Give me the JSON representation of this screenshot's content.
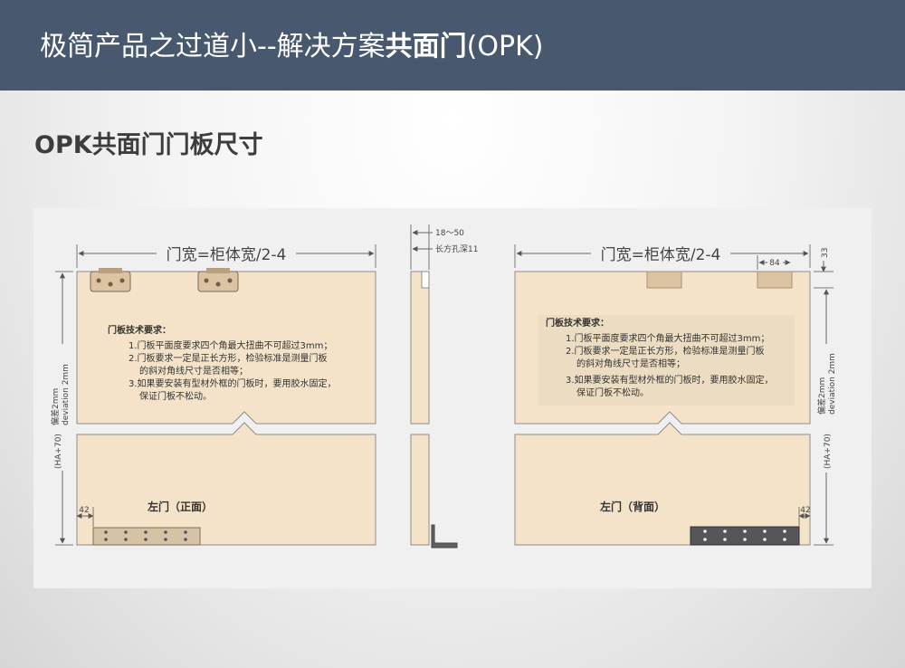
{
  "header": {
    "title_regular": "极简产品之过道小--解决方案",
    "title_bold": "共面门",
    "title_suffix": "(OPK)"
  },
  "section": {
    "heading": "OPK共面门门板尺寸"
  },
  "diagram": {
    "door_width_formula": "门宽=柜体宽/2-4",
    "side_gap_range": "18～50",
    "slot_depth": "长方孔深11",
    "dim_84": "84",
    "dim_33": "33",
    "dim_42": "42",
    "height_formula": "(HA+70)",
    "deviation_cn": "偏差2mm",
    "deviation_en": "deviation 2mm",
    "requirements": {
      "title": "门板技术要求：",
      "items": [
        "1.门板平面度要求四个角最大扭曲不可超过3mm；",
        "2.门板要求一定是正长方形，检验标准是测量门板",
        "的斜对角线尺寸是否相等；",
        "3.如果要安装有型材外框的门板时，要用胶水固定，",
        "保证门板不松动。"
      ]
    },
    "left_door_label": "左门（正面）",
    "right_door_label": "左门（背面）"
  }
}
